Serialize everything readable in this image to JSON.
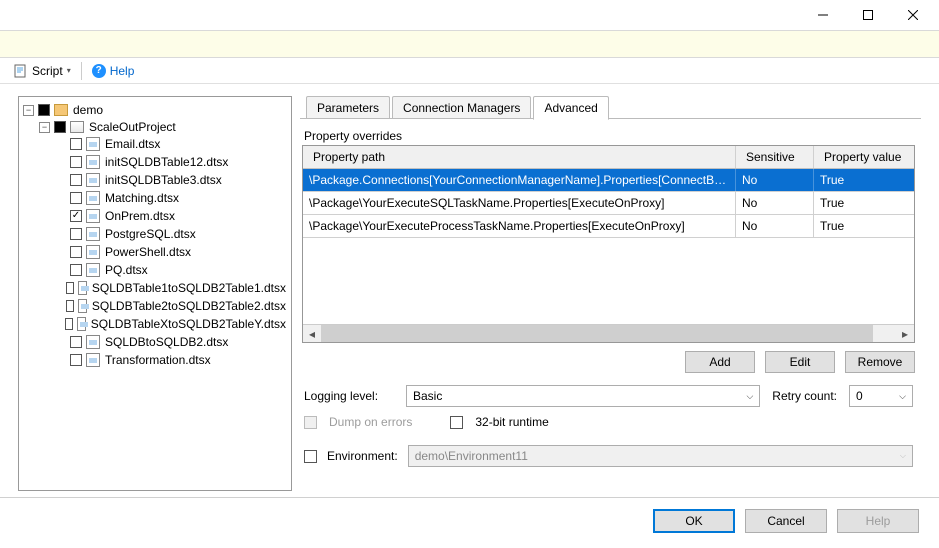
{
  "titlebar": {},
  "toolbar": {
    "script_label": "Script",
    "help_label": "Help"
  },
  "tree": {
    "root": {
      "label": "demo"
    },
    "project": {
      "label": "ScaleOutProject"
    },
    "packages": [
      {
        "label": "Email.dtsx",
        "checked": false
      },
      {
        "label": "initSQLDBTable12.dtsx",
        "checked": false
      },
      {
        "label": "initSQLDBTable3.dtsx",
        "checked": false
      },
      {
        "label": "Matching.dtsx",
        "checked": false
      },
      {
        "label": "OnPrem.dtsx",
        "checked": true
      },
      {
        "label": "PostgreSQL.dtsx",
        "checked": false
      },
      {
        "label": "PowerShell.dtsx",
        "checked": false
      },
      {
        "label": "PQ.dtsx",
        "checked": false
      },
      {
        "label": "SQLDBTable1toSQLDB2Table1.dtsx",
        "checked": false
      },
      {
        "label": "SQLDBTable2toSQLDB2Table2.dtsx",
        "checked": false
      },
      {
        "label": "SQLDBTableXtoSQLDB2TableY.dtsx",
        "checked": false
      },
      {
        "label": "SQLDBtoSQLDB2.dtsx",
        "checked": false
      },
      {
        "label": "Transformation.dtsx",
        "checked": false
      }
    ]
  },
  "tabs": {
    "parameters": "Parameters",
    "connection_managers": "Connection Managers",
    "advanced": "Advanced"
  },
  "section_overrides_label": "Property overrides",
  "grid": {
    "columns": {
      "path": "Property path",
      "sensitive": "Sensitive",
      "value": "Property value"
    },
    "rows": [
      {
        "path": "\\Package.Connections[YourConnectionManagerName].Properties[ConnectByProxy]",
        "sensitive": "No",
        "value": "True"
      },
      {
        "path": "\\Package\\YourExecuteSQLTaskName.Properties[ExecuteOnProxy]",
        "sensitive": "No",
        "value": "True"
      },
      {
        "path": "\\Package\\YourExecuteProcessTaskName.Properties[ExecuteOnProxy]",
        "sensitive": "No",
        "value": "True"
      }
    ]
  },
  "actions": {
    "add": "Add",
    "edit": "Edit",
    "remove": "Remove"
  },
  "form": {
    "logging_level_label": "Logging level:",
    "logging_level_value": "Basic",
    "retry_count_label": "Retry count:",
    "retry_count_value": "0",
    "dump_label": "Dump on errors",
    "runtime_label": "32-bit runtime",
    "env_label": "Environment:",
    "env_value": "demo\\Environment11"
  },
  "bottom": {
    "ok": "OK",
    "cancel": "Cancel",
    "help": "Help"
  }
}
